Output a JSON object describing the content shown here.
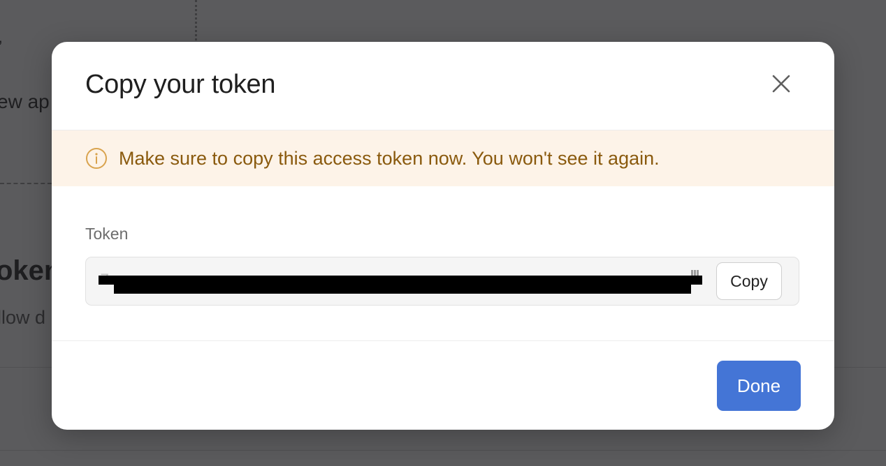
{
  "background": {
    "partial_text_1": "’",
    "partial_text_2": "ew ap",
    "partial_text_3": "oken",
    "partial_text_4": "llow d"
  },
  "modal": {
    "title": "Copy your token",
    "close_icon": "close-icon",
    "warning": {
      "icon": "info-circle-icon",
      "text": "Make sure to copy this access token now. You won't see it again.",
      "background_color": "#fdf3e8",
      "text_color": "#8a5a0e"
    },
    "token": {
      "label": "Token",
      "value_redacted": "Z•••••••••••••••••••••••••••••••••••••••••••••",
      "copy_label": "Copy"
    },
    "done_label": "Done",
    "accent_color": "#4475d6"
  }
}
